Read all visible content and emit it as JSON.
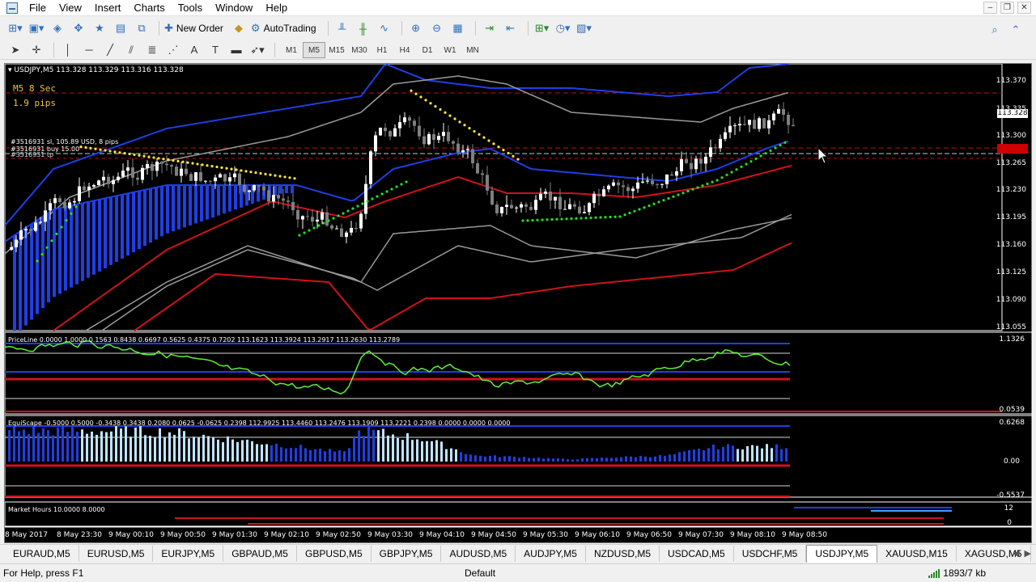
{
  "menu": [
    "File",
    "View",
    "Insert",
    "Charts",
    "Tools",
    "Window",
    "Help"
  ],
  "toolbar": {
    "new_order": "New Order",
    "autotrading": "AutoTrading"
  },
  "timeframes": [
    "M1",
    "M5",
    "M15",
    "M30",
    "H1",
    "H4",
    "D1",
    "W1",
    "MN"
  ],
  "active_timeframe": "M5",
  "chart": {
    "header": "USDJPY,M5  113.328 113.329 113.316 113.328",
    "timer": "M5 8 Sec",
    "spread": "1.9 pips",
    "order_line_1": "#3516931 sl, 105.89 USD, 8 pips",
    "order_line_2": "#3516931 buy 15.00",
    "order_line_3": "#3516931 tp",
    "bid_tag": "113.328",
    "price_ticks": [
      "113.370",
      "113.335",
      "113.300",
      "113.265",
      "113.230",
      "113.195",
      "113.160",
      "113.125",
      "113.090",
      "113.055"
    ],
    "time_ticks": [
      "8 May 2017",
      "8 May 23:30",
      "9 May 00:10",
      "9 May 00:50",
      "9 May 01:30",
      "9 May 02:10",
      "9 May 02:50",
      "9 May 03:30",
      "9 May 04:10",
      "9 May 04:50",
      "9 May 05:30",
      "9 May 06:10",
      "9 May 06:50",
      "9 May 07:30",
      "9 May 08:10",
      "9 May 08:50"
    ],
    "sub1": {
      "label": "PriceLine 0.0000 1.0000 0.1563 0.8438 0.6697 0.5625 0.4375 0.7202 113.1623 113.3924 113.2917 113.2630 113.2789",
      "top": "1.1326",
      "bottom": "0.0539"
    },
    "sub2": {
      "label": "EquiScape -0.5000 0.5000 -0.3438 0.3438 0.2080 0.0625 -0.0625 0.2398 112.9925 113.4460 113.2476 113.1909 113.2221 0.2398 0.0000 0.0000 0.0000",
      "top": "0.6268",
      "mid": "0.00",
      "bottom": "-0.5537"
    },
    "sub3": {
      "label": "Market Hours 10.0000 8.0000",
      "top": "12",
      "bottom": "0"
    }
  },
  "symbols": [
    "EURAUD,M5",
    "EURUSD,M5",
    "EURJPY,M5",
    "GBPAUD,M5",
    "GBPUSD,M5",
    "GBPJPY,M5",
    "AUDUSD,M5",
    "AUDJPY,M5",
    "NZDUSD,M5",
    "USDCAD,M5",
    "USDCHF,M5",
    "USDJPY,M5",
    "XAUUSD,M15",
    "XAGUSD,M5"
  ],
  "active_symbol": "USDJPY,M5",
  "status": {
    "help": "For Help, press F1",
    "profile": "Default",
    "traffic": "1893/7 kb"
  },
  "colors": {
    "bull": "#ffffff",
    "bear": "#7f7f7f",
    "upper": "#1e3fe6",
    "lower": "#d0111b",
    "mid": "#9a9a9a",
    "dotsUp": "#ffe53d",
    "dotsDn": "#22e022",
    "osc": "#5ef03a"
  }
}
